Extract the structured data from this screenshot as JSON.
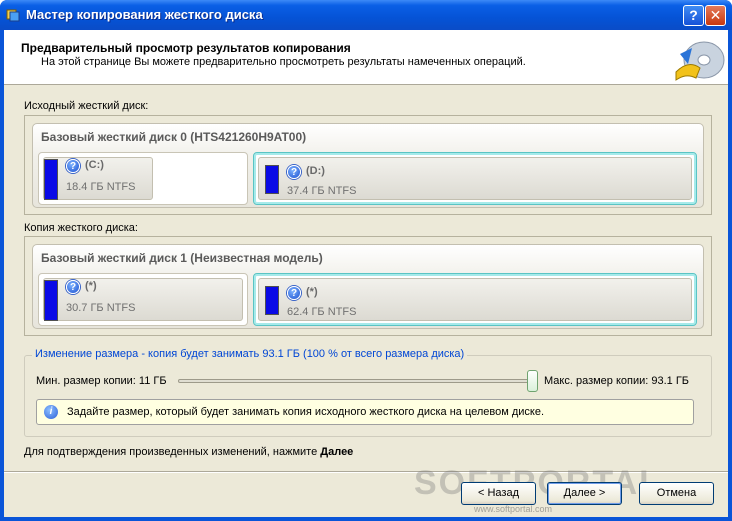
{
  "window": {
    "title": "Мастер копирования жесткого диска",
    "help_label": "?",
    "close_label": "✕"
  },
  "header": {
    "title": "Предварительный просмотр результатов копирования",
    "subtitle": "На этой странице Вы можете предварительно просмотреть результаты намеченных операций."
  },
  "source": {
    "section_label": "Исходный жесткий диск:",
    "disk_title": "Базовый жесткий диск 0 (HTS421260H9AT00)",
    "partitions": [
      {
        "label": "(C:)",
        "size": "18.4 ГБ NTFS"
      },
      {
        "label": "(D:)",
        "size": "37.4 ГБ NTFS"
      }
    ]
  },
  "copy": {
    "section_label": "Копия жесткого диска:",
    "disk_title": "Базовый жесткий диск 1 (Неизвестная модель)",
    "partitions": [
      {
        "label": "(*)",
        "size": "30.7 ГБ NTFS"
      },
      {
        "label": "(*)",
        "size": "62.4 ГБ NTFS"
      }
    ]
  },
  "resize": {
    "title": "Изменение размера - копия будет занимать 93.1 ГБ (100 % от всего размера диска)",
    "min_label": "Мин. размер копии:  11 ГБ",
    "max_label": "Макс. размер копии:  93.1 ГБ",
    "slider_percent": 100,
    "info_icon_glyph": "i",
    "info_text": "Задайте размер, который будет занимать копия исходного жесткого диска на целевом диске."
  },
  "confirm": {
    "text": "Для подтверждения произведенных изменений, нажмите",
    "bold": "Далее"
  },
  "buttons": {
    "back": "< Назад",
    "next": "Далее >",
    "cancel": "Отмена"
  },
  "watermark": {
    "text": "SOFTPORTAL",
    "url": "www.softportal.com"
  },
  "icons": {
    "title": "disk-copy-icon",
    "logo": "disk-wizard-logo-icon",
    "partition": "question-icon",
    "info": "info-icon"
  },
  "colors": {
    "titlebar": "#0553d6",
    "partition_bar": "#0a0ae6",
    "selected_border": "#5ac4c4",
    "resize_title": "#0046d5",
    "info_bg": "#ffffe1"
  }
}
